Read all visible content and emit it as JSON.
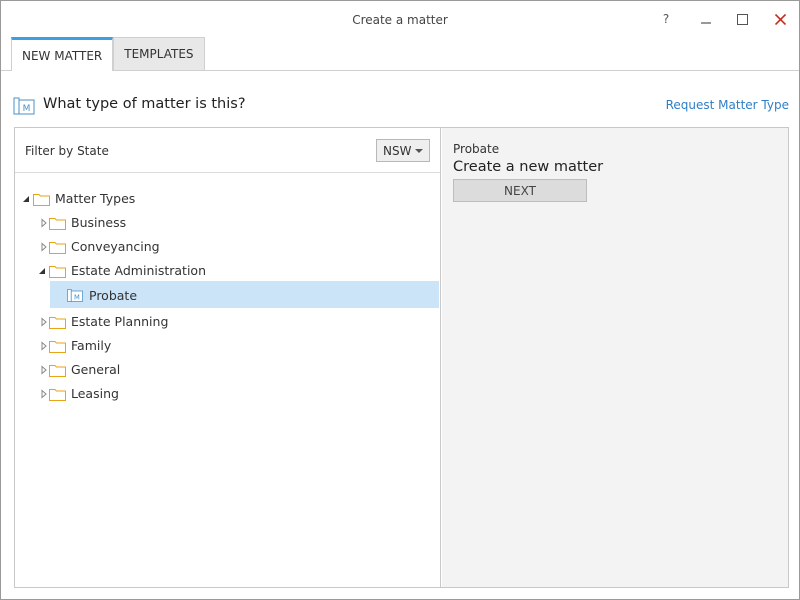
{
  "window": {
    "title": "Create a matter",
    "help_glyph": "?",
    "colors": {
      "close": "#c42b1c",
      "accent": "#3b9fe0",
      "link": "#2f7fc7",
      "folder": "#e8a317",
      "selection": "#cce4f7"
    }
  },
  "tabs": [
    {
      "label": "NEW MATTER",
      "active": true
    },
    {
      "label": "TEMPLATES",
      "active": false
    }
  ],
  "heading": {
    "icon": "matter-icon",
    "text": "What type of matter is this?",
    "request_link": "Request Matter Type"
  },
  "filter": {
    "label": "Filter by State",
    "selected_state": "NSW"
  },
  "tree": {
    "root": {
      "label": "Matter Types",
      "expanded": true
    },
    "items": [
      {
        "label": "Business",
        "expanded": false
      },
      {
        "label": "Conveyancing",
        "expanded": false
      },
      {
        "label": "Estate Administration",
        "expanded": true
      },
      {
        "label": "Probate",
        "selected": true,
        "icon": "matter-icon"
      },
      {
        "label": "Estate Planning",
        "expanded": false
      },
      {
        "label": "Family",
        "expanded": false
      },
      {
        "label": "General",
        "expanded": false
      },
      {
        "label": "Leasing",
        "expanded": false
      }
    ]
  },
  "detail": {
    "category": "Probate",
    "headline": "Create a new matter",
    "next_label": "NEXT"
  }
}
